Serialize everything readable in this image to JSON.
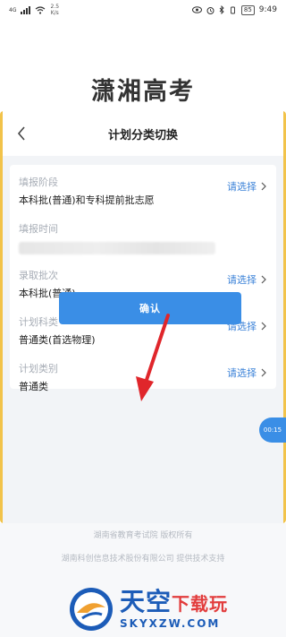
{
  "status_bar": {
    "network_label": "4G",
    "speed_value": "2.5",
    "speed_unit": "K/s",
    "battery": "85",
    "time": "9:49"
  },
  "app_title": "潇湘高考",
  "modal": {
    "title": "计划分类切换",
    "choose_label": "请选择",
    "fields": [
      {
        "label": "填报阶段",
        "value": "本科批(普通)和专科提前批志愿"
      },
      {
        "label": "填报时间",
        "value": ""
      },
      {
        "label": "录取批次",
        "value": "本科批(普通)"
      },
      {
        "label": "计划科类",
        "value": "普通类(首选物理)"
      },
      {
        "label": "计划类别",
        "value": "普通类"
      }
    ],
    "confirm_label": "确认"
  },
  "timer_bubble": "00:15",
  "footer": {
    "line1": "湖南省教育考试院 版权所有",
    "line2": "湖南科创信息技术股份有限公司 提供技术支持"
  },
  "watermark": {
    "cn_main": "天空",
    "cn_accent": "下载玩",
    "en": "SKYXZW.COM"
  },
  "colors": {
    "accent_blue": "#3a8ee6",
    "choose_blue": "#3b82d8",
    "arrow_red": "#e0262b",
    "border_gold": "#f2c34a"
  }
}
